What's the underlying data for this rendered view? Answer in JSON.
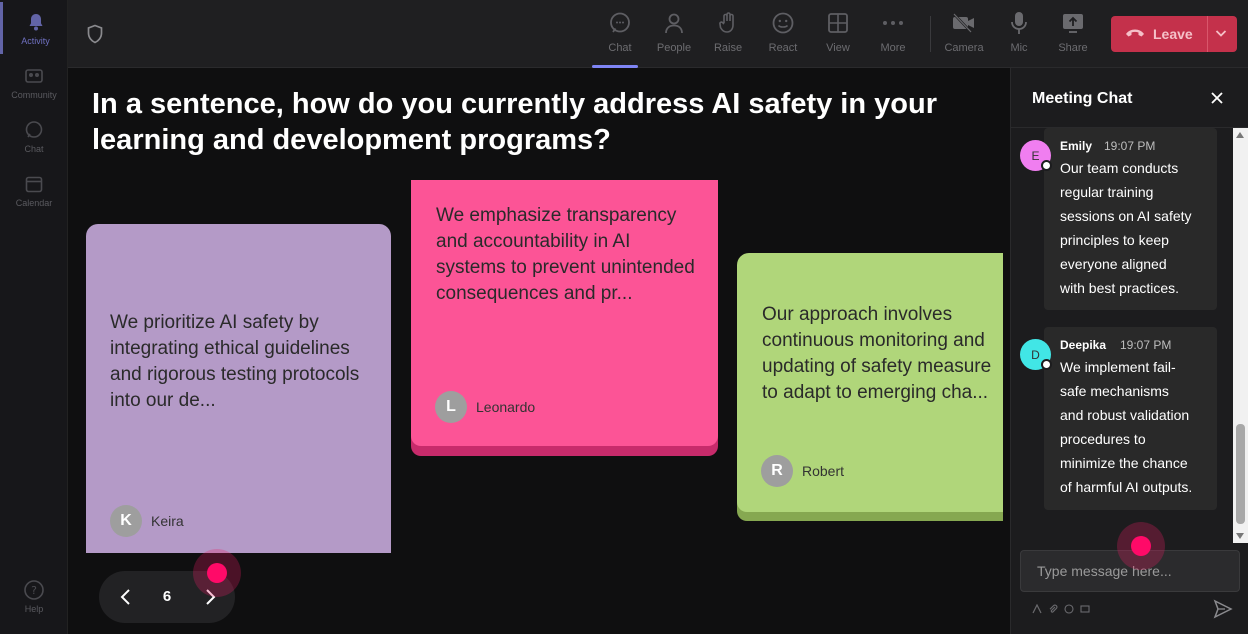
{
  "rail": {
    "items": [
      {
        "label": "Activity",
        "icon": "bell-icon"
      },
      {
        "label": "Community",
        "icon": "community-icon"
      },
      {
        "label": "Chat",
        "icon": "chat-icon"
      },
      {
        "label": "Calendar",
        "icon": "calendar-icon"
      },
      {
        "label": "Help",
        "icon": "help-icon"
      }
    ]
  },
  "toolbar": {
    "buttons": [
      {
        "label": "Chat",
        "icon": "chat-icon"
      },
      {
        "label": "People",
        "icon": "people-icon"
      },
      {
        "label": "Raise",
        "icon": "raise-hand-icon"
      },
      {
        "label": "React",
        "icon": "react-icon"
      },
      {
        "label": "View",
        "icon": "view-icon"
      },
      {
        "label": "More",
        "icon": "more-icon"
      },
      {
        "label": "Camera",
        "icon": "camera-icon"
      },
      {
        "label": "Mic",
        "icon": "mic-icon"
      },
      {
        "label": "Share",
        "icon": "share-icon"
      }
    ],
    "leave_label": "Leave",
    "leave_color": "#c4314b",
    "accent_color": "#7f85f5"
  },
  "stage": {
    "question": "In a sentence, how do you currently address AI safety in your learning and development programs?",
    "notes": [
      {
        "text": "We prioritize AI safety by integrating ethical guidelines and rigorous testing protocols into our de...",
        "author": "Keira",
        "initial": "K",
        "color": "#b49ac7"
      },
      {
        "text": "We emphasize transparency and accountability in AI systems to prevent unintended consequences and pr...",
        "author": "Leonardo",
        "initial": "L",
        "color": "#fc5496"
      },
      {
        "text_lines": [
          "Our approach involves",
          "continuous monitoring and",
          "updating of safety measure",
          "to adapt to emerging cha..."
        ],
        "author": "Robert",
        "initial": "R",
        "color": "#b0d67a"
      }
    ],
    "page_number": "6"
  },
  "chat": {
    "title": "Meeting Chat",
    "messages": [
      {
        "name": "Emily",
        "time": "19:07 PM",
        "initial": "E",
        "avatar_color": "#f07ef0",
        "lines": [
          "Our team conducts",
          "regular training",
          "sessions on AI safety",
          "principles to keep",
          "everyone aligned",
          "with best practices."
        ]
      },
      {
        "name": "Deepika",
        "time": "19:07 PM",
        "initial": "D",
        "avatar_color": "#41e6e6",
        "lines": [
          "We implement fail-",
          "safe mechanisms",
          "and robust validation",
          "procedures to",
          "minimize the chance",
          "of harmful AI outputs."
        ]
      }
    ],
    "input_placeholder": "Type message here..."
  }
}
